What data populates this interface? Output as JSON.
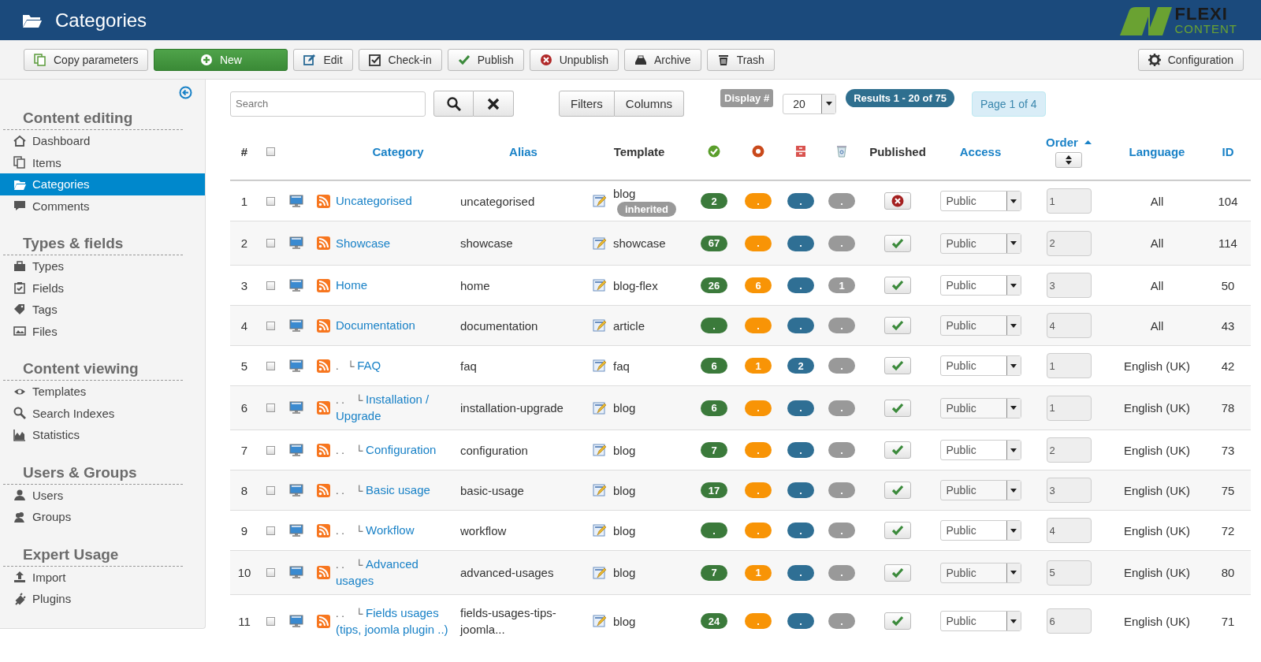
{
  "header": {
    "title": "Categories",
    "logo": {
      "line_1": "FLEXI",
      "line_2": "CONTENT"
    }
  },
  "toolbar": {
    "buttons": [
      {
        "label": "Copy parameters",
        "kind": "default"
      },
      {
        "label": "New",
        "kind": "success"
      },
      {
        "label": "Edit",
        "kind": "default"
      },
      {
        "label": "Check-in",
        "kind": "default"
      },
      {
        "label": "Publish",
        "kind": "default"
      },
      {
        "label": "Unpublish",
        "kind": "default"
      },
      {
        "label": "Archive",
        "kind": "default"
      },
      {
        "label": "Trash",
        "kind": "default"
      }
    ],
    "right_buttons": [
      {
        "label": "Configuration",
        "kind": "default"
      }
    ]
  },
  "sidebar": {
    "sections": [
      {
        "title": "Content editing",
        "items": [
          {
            "label": "Dashboard",
            "selected": false
          },
          {
            "label": "Items",
            "selected": false
          },
          {
            "label": "Categories",
            "selected": true
          },
          {
            "label": "Comments",
            "selected": false
          }
        ]
      },
      {
        "title": "Types & fields",
        "items": [
          {
            "label": "Types",
            "selected": false
          },
          {
            "label": "Fields",
            "selected": false
          },
          {
            "label": "Tags",
            "selected": false
          },
          {
            "label": "Files",
            "selected": false
          }
        ]
      },
      {
        "title": "Content viewing",
        "items": [
          {
            "label": "Templates",
            "selected": false
          },
          {
            "label": "Search Indexes",
            "selected": false
          },
          {
            "label": "Statistics",
            "selected": false
          }
        ]
      },
      {
        "title": "Users & Groups",
        "items": [
          {
            "label": "Users",
            "selected": false
          },
          {
            "label": "Groups",
            "selected": false
          }
        ]
      },
      {
        "title": "Expert Usage",
        "items": [
          {
            "label": "Import",
            "selected": false
          },
          {
            "label": "Plugins",
            "selected": false
          }
        ]
      }
    ]
  },
  "filters": {
    "search": {
      "placeholder": "Search"
    },
    "buttons": [
      "Filters",
      "Columns"
    ],
    "display_label": "Display #",
    "display_value": "20",
    "results": "Results 1 - 20 of 75",
    "page": "Page 1 of 4"
  },
  "table": {
    "header_checked": false,
    "columns": [
      {
        "label": "#",
        "sortable": false
      },
      {
        "label": "Category",
        "sortable": true
      },
      {
        "label": "Alias",
        "sortable": true
      },
      {
        "label": "Template",
        "sortable": false
      },
      {
        "label": "Published",
        "sortable": false
      },
      {
        "label": "Access",
        "sortable": true
      },
      {
        "label": "Order",
        "sortable": true
      },
      {
        "label": "Language",
        "sortable": true
      },
      {
        "label": "ID",
        "sortable": true
      }
    ],
    "count_columns": [
      {
        "color": "#3b7a3b"
      },
      {
        "color": "#f89406"
      },
      {
        "color": "#2f6f94"
      },
      {
        "color": "#999999"
      }
    ],
    "rows": [
      {
        "number": "1",
        "checked": false,
        "category": "Uncategorised",
        "alias": "uncategorised",
        "template": "blog",
        "template_badge": "inherited",
        "counts": [
          "2",
          ".",
          ".",
          "."
        ],
        "published": false,
        "access": "Public",
        "order": "1",
        "language": "All",
        "id": "104"
      },
      {
        "number": "2",
        "checked": false,
        "category": "Showcase",
        "alias": "showcase",
        "template": "showcase",
        "counts": [
          "67",
          ".",
          ".",
          "."
        ],
        "published": true,
        "access": "Public",
        "order": "2",
        "language": "All",
        "id": "114"
      },
      {
        "number": "3",
        "checked": false,
        "category": "Home",
        "alias": "home",
        "template": "blog-flex",
        "counts": [
          "26",
          "6",
          ".",
          "1"
        ],
        "published": true,
        "access": "Public",
        "order": "3",
        "language": "All",
        "id": "50"
      },
      {
        "number": "4",
        "checked": false,
        "category": "Documentation",
        "alias": "documentation",
        "template": "article",
        "counts": [
          ".",
          ".",
          ".",
          "."
        ],
        "published": true,
        "access": "Public",
        "order": "4",
        "language": "All",
        "id": "43",
        "children": [
          {
            "number": "5",
            "checked": false,
            "prefix": ".   └",
            "category": "FAQ",
            "alias": "faq",
            "template": "faq",
            "counts": [
              "6",
              "1",
              "2",
              "."
            ],
            "published": true,
            "access": "Public",
            "order": "1",
            "language": "English (UK)",
            "id": "42",
            "children": [
              {
                "number": "6",
                "checked": false,
                "prefix": ". .    └",
                "category": "Installation / Upgrade",
                "alias": "installation-upgrade",
                "template": "blog",
                "counts": [
                  "6",
                  ".",
                  ".",
                  "."
                ],
                "published": true,
                "access": "Public",
                "order": "1",
                "language": "English (UK)",
                "id": "78"
              },
              {
                "number": "7",
                "checked": false,
                "prefix": ". .    └",
                "category": "Configuration",
                "alias": "configuration",
                "template": "blog",
                "counts": [
                  "7",
                  ".",
                  ".",
                  "."
                ],
                "published": true,
                "access": "Public",
                "order": "2",
                "language": "English (UK)",
                "id": "73"
              },
              {
                "number": "8",
                "checked": false,
                "prefix": ". .    └",
                "category": "Basic usage",
                "alias": "basic-usage",
                "template": "blog",
                "counts": [
                  "17",
                  ".",
                  ".",
                  "."
                ],
                "published": true,
                "access": "Public",
                "order": "3",
                "language": "English (UK)",
                "id": "75"
              },
              {
                "number": "9",
                "checked": false,
                "prefix": ". .    └",
                "category": "Workflow",
                "alias": "workflow",
                "template": "blog",
                "counts": [
                  ".",
                  ".",
                  ".",
                  "."
                ],
                "published": true,
                "access": "Public",
                "order": "4",
                "language": "English (UK)",
                "id": "72"
              },
              {
                "number": "10",
                "checked": false,
                "prefix": ". .    └",
                "category": "Advanced usages",
                "alias": "advanced-usages",
                "template": "blog",
                "counts": [
                  "7",
                  "1",
                  ".",
                  "."
                ],
                "published": true,
                "access": "Public",
                "order": "5",
                "language": "English (UK)",
                "id": "80"
              },
              {
                "number": "11",
                "checked": false,
                "prefix": ". .    └",
                "category": "Fields usages (tips, joomla plugin ..)",
                "alias": "fields-usages-tips-joomla...",
                "template": "blog",
                "counts": [
                  "24",
                  ".",
                  ".",
                  "."
                ],
                "published": true,
                "access": "Public",
                "order": "6",
                "language": "English (UK)",
                "id": "71"
              }
            ]
          }
        ]
      }
    ]
  }
}
